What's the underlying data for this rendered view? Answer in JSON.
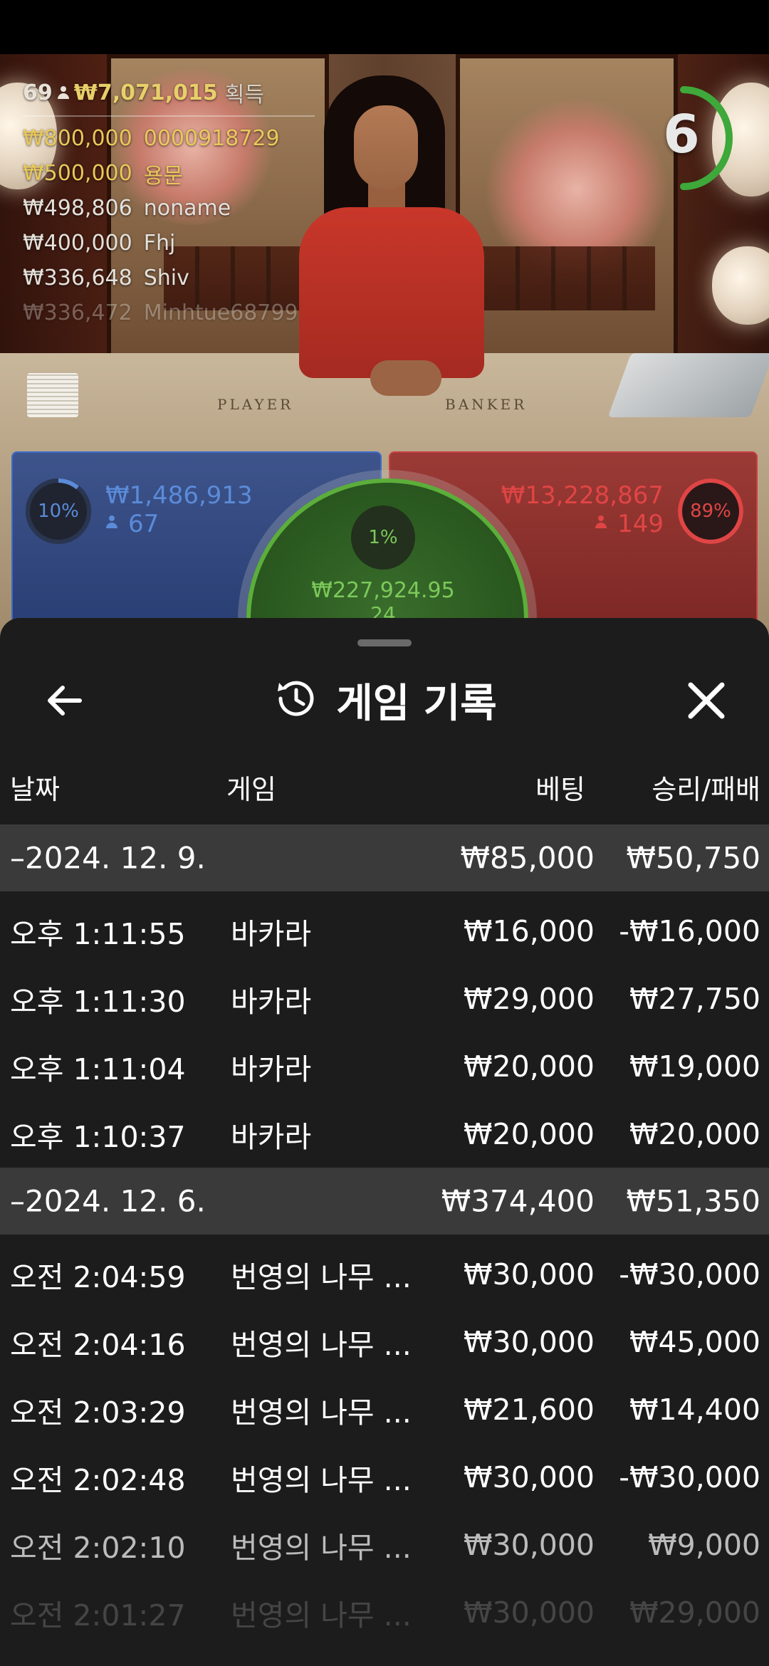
{
  "leaderboard": {
    "players_count": "69",
    "total_won": "₩7,071,015",
    "won_label": "획득",
    "rows": [
      {
        "amount": "₩800,000",
        "name": "0000918729"
      },
      {
        "amount": "₩500,000",
        "name": "용문"
      },
      {
        "amount": "₩498,806",
        "name": "noname"
      },
      {
        "amount": "₩400,000",
        "name": "Fhj"
      },
      {
        "amount": "₩336,648",
        "name": "Shiv"
      },
      {
        "amount": "₩336,472",
        "name": "Minhtue68799"
      }
    ]
  },
  "table_labels": {
    "player": "PLAYER",
    "banker": "BANKER"
  },
  "timer": {
    "seconds": "6",
    "fraction_remaining": 0.35
  },
  "bets": {
    "player": {
      "percent": "10%",
      "amount": "₩1,486,913",
      "count": "67"
    },
    "tie": {
      "percent": "1%",
      "amount": "₩227,924.95",
      "count": "24"
    },
    "banker": {
      "percent": "89%",
      "amount": "₩13,228,867",
      "count": "149"
    }
  },
  "sheet": {
    "title": "게임 기록",
    "columns": {
      "date": "날짜",
      "game": "게임",
      "bet": "베팅",
      "result": "승리/패배"
    },
    "groups": [
      {
        "date": "–2024. 12. 9.",
        "bet": "₩85,000",
        "result": "₩50,750",
        "rows": [
          {
            "time": "오후 1:11:55",
            "game": "바카라",
            "bet": "₩16,000",
            "result": "-₩16,000"
          },
          {
            "time": "오후 1:11:30",
            "game": "바카라",
            "bet": "₩29,000",
            "result": "₩27,750"
          },
          {
            "time": "오후 1:11:04",
            "game": "바카라",
            "bet": "₩20,000",
            "result": "₩19,000"
          },
          {
            "time": "오후 1:10:37",
            "game": "바카라",
            "bet": "₩20,000",
            "result": "₩20,000"
          }
        ]
      },
      {
        "date": "–2024. 12. 6.",
        "bet": "₩374,400",
        "result": "₩51,350",
        "rows": [
          {
            "time": "오전 2:04:59",
            "game": "번영의 나무 ...",
            "bet": "₩30,000",
            "result": "-₩30,000"
          },
          {
            "time": "오전 2:04:16",
            "game": "번영의 나무 ...",
            "bet": "₩30,000",
            "result": "₩45,000"
          },
          {
            "time": "오전 2:03:29",
            "game": "번영의 나무 ...",
            "bet": "₩21,600",
            "result": "₩14,400"
          },
          {
            "time": "오전 2:02:48",
            "game": "번영의 나무 ...",
            "bet": "₩30,000",
            "result": "-₩30,000"
          },
          {
            "time": "오전 2:02:10",
            "game": "번영의 나무 ...",
            "bet": "₩30,000",
            "result": "₩9,000"
          },
          {
            "time": "오전 2:01:27",
            "game": "번영의 나무 ...",
            "bet": "₩30,000",
            "result": "₩29,000"
          }
        ]
      }
    ]
  },
  "icons": {
    "back": "arrow-left-icon",
    "history": "history-clock-icon",
    "close": "close-icon",
    "person": "person-icon"
  }
}
